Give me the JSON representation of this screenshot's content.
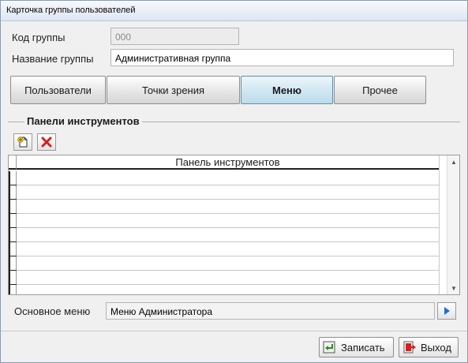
{
  "window": {
    "title": "Карточка группы пользователей"
  },
  "form": {
    "code_label": "Код группы",
    "code_value": "000",
    "name_label": "Название группы",
    "name_value": "Административная группа"
  },
  "tabs": [
    {
      "label": "Пользователи",
      "active": false
    },
    {
      "label": "Точки зрения",
      "active": false
    },
    {
      "label": "Меню",
      "active": true
    },
    {
      "label": "Прочее",
      "active": false
    }
  ],
  "toolbars_section": {
    "title": "Панели инструментов",
    "add_icon": "add-document-icon",
    "delete_icon": "delete-x-icon",
    "grid": {
      "columns": [
        "Панель инструментов"
      ],
      "rows": [
        "",
        "",
        "",
        "",
        "",
        "",
        "",
        "",
        ""
      ]
    }
  },
  "main_menu": {
    "label": "Основное меню",
    "value": "Меню Администратора",
    "select_icon": "play-arrow-icon"
  },
  "footer": {
    "save_label": "Записать",
    "exit_label": "Выход"
  },
  "colors": {
    "active_tab": "#cfe6f2",
    "select_arrow": "#1f6fd1",
    "delete_red": "#d32020"
  }
}
